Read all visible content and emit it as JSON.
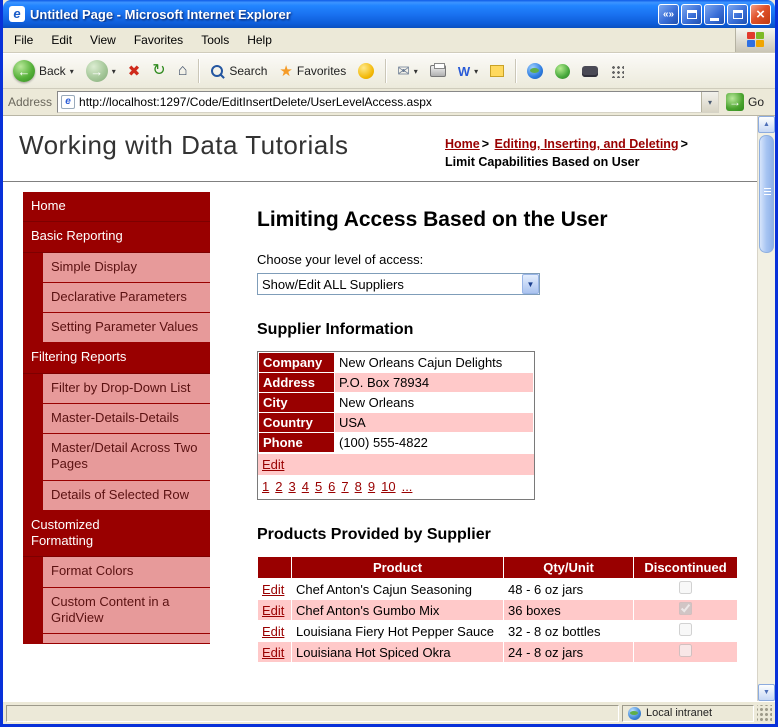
{
  "colors": {
    "titlebar_blue": "#1971f0",
    "accent_dark_red": "#990000",
    "sidebar_pink": "#e79a9a",
    "row_pink": "#ffc9c9",
    "chrome_tan": "#ece9d8"
  },
  "icons": {
    "ie_logo": "e",
    "chevrons": "«»",
    "close": "×",
    "back_arrow": "←",
    "forward_arrow": "→",
    "stop": "✖",
    "refresh": "↻",
    "home": "⌂",
    "star": "★",
    "mail": "✉",
    "word_edit": "W",
    "caret_down": "▾",
    "combo_arrow": "▼",
    "scroll_up": "▲",
    "scroll_down": "▼",
    "go_arrow": "→",
    "breadcrumb_sep": ">"
  },
  "window": {
    "title": "Untitled Page - Microsoft Internet Explorer",
    "status_right": "Local intranet"
  },
  "menu": {
    "items": [
      "File",
      "Edit",
      "View",
      "Favorites",
      "Tools",
      "Help"
    ]
  },
  "toolbar": {
    "back_label": "Back",
    "search_label": "Search",
    "favorites_label": "Favorites"
  },
  "address": {
    "label": "Address",
    "url": "http://localhost:1297/Code/EditInsertDelete/UserLevelAccess.aspx",
    "go_label": "Go"
  },
  "header": {
    "site_title": "Working with Data Tutorials",
    "breadcrumb": {
      "home": "Home",
      "section": "Editing, Inserting, and Deleting",
      "current": "Limit Capabilities Based on User"
    }
  },
  "sidebar": {
    "items": [
      {
        "label": "Home",
        "type": "section"
      },
      {
        "label": "Basic Reporting",
        "type": "section"
      },
      {
        "label": "Simple Display",
        "type": "sub"
      },
      {
        "label": "Declarative Parameters",
        "type": "sub"
      },
      {
        "label": "Setting Parameter Values",
        "type": "sub"
      },
      {
        "label": "Filtering Reports",
        "type": "section"
      },
      {
        "label": "Filter by Drop-Down List",
        "type": "sub"
      },
      {
        "label": "Master-Details-Details",
        "type": "sub"
      },
      {
        "label": "Master/Detail Across Two Pages",
        "type": "sub"
      },
      {
        "label": "Details of Selected Row",
        "type": "sub"
      },
      {
        "label": "Customized Formatting",
        "type": "section"
      },
      {
        "label": "Format Colors",
        "type": "sub"
      },
      {
        "label": "Custom Content in a GridView",
        "type": "sub"
      },
      {
        "label": "",
        "type": "sub"
      }
    ]
  },
  "main": {
    "heading": "Limiting Access Based on the User",
    "access_label": "Choose your level of access:",
    "access_value": "Show/Edit ALL Suppliers",
    "supplier_heading": "Supplier Information",
    "supplier": {
      "rows": [
        {
          "label": "Company",
          "value": "New Orleans Cajun Delights"
        },
        {
          "label": "Address",
          "value": "P.O. Box 78934"
        },
        {
          "label": "City",
          "value": "New Orleans"
        },
        {
          "label": "Country",
          "value": "USA"
        },
        {
          "label": "Phone",
          "value": "(100) 555-4822"
        }
      ],
      "edit_label": "Edit",
      "pager": [
        "1",
        "2",
        "3",
        "4",
        "5",
        "6",
        "7",
        "8",
        "9",
        "10",
        "..."
      ]
    },
    "products_heading": "Products Provided by Supplier",
    "products": {
      "headers": {
        "edit": "",
        "product": "Product",
        "qty": "Qty/Unit",
        "discontinued": "Discontinued"
      },
      "edit_label": "Edit",
      "rows": [
        {
          "product": "Chef Anton's Cajun Seasoning",
          "qty": "48 - 6 oz jars",
          "discontinued": false
        },
        {
          "product": "Chef Anton's Gumbo Mix",
          "qty": "36 boxes",
          "discontinued": true
        },
        {
          "product": "Louisiana Fiery Hot Pepper Sauce",
          "qty": "32 - 8 oz bottles",
          "discontinued": false
        },
        {
          "product": "Louisiana Hot Spiced Okra",
          "qty": "24 - 8 oz jars",
          "discontinued": false
        }
      ]
    }
  }
}
